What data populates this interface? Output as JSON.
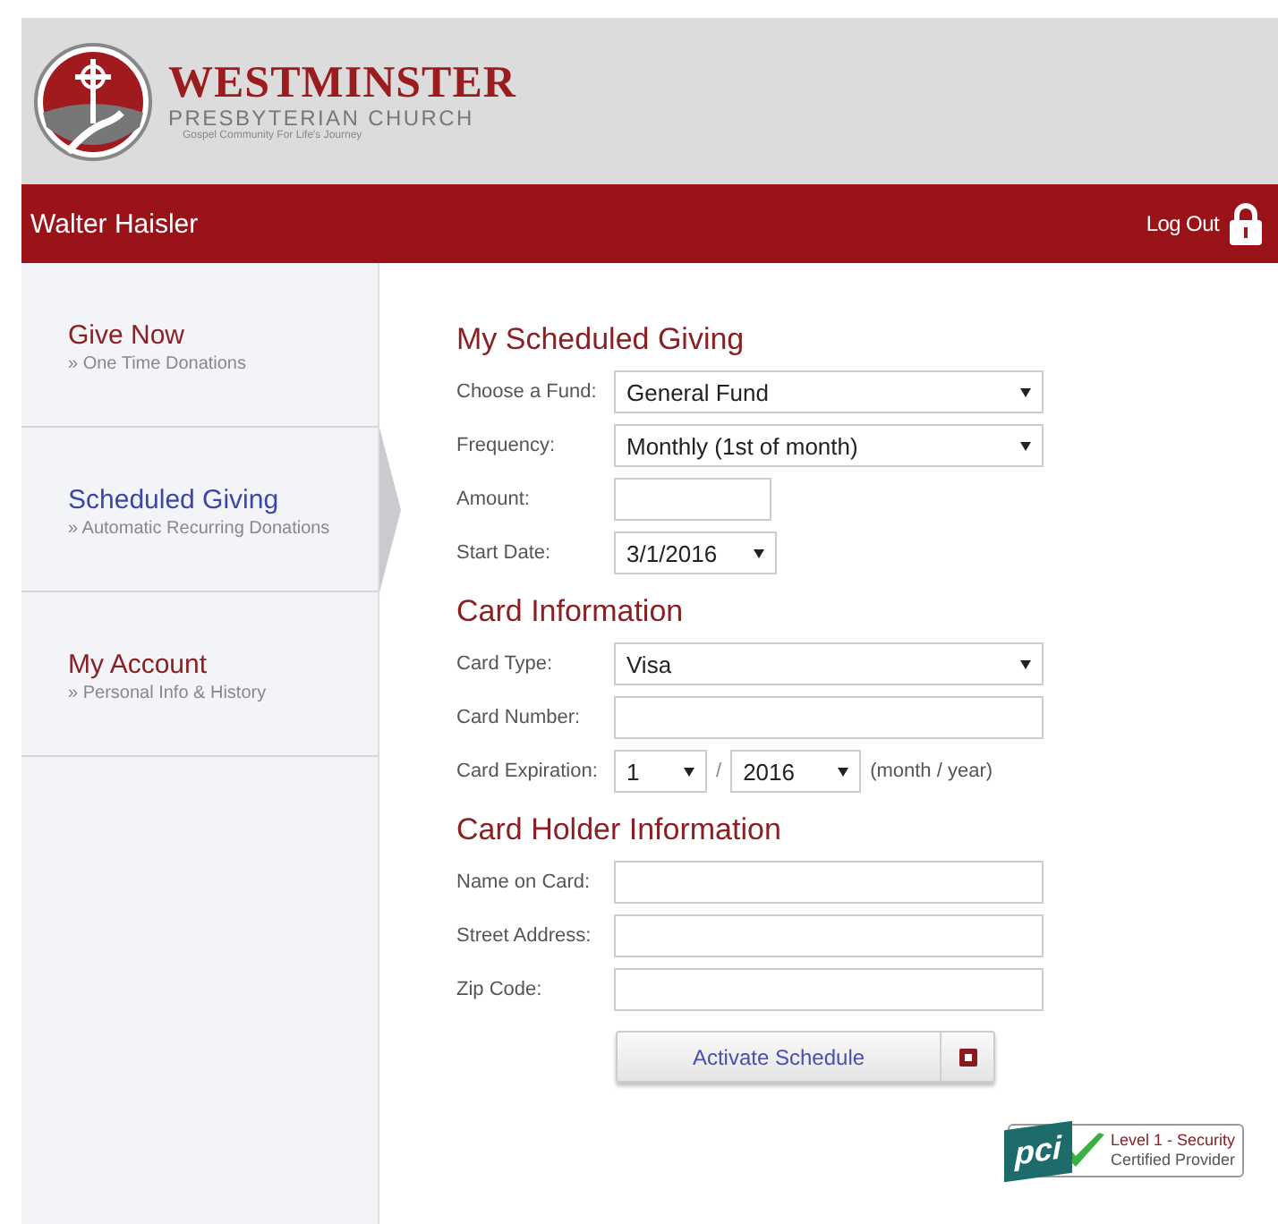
{
  "logo": {
    "name": "WESTMINSTER",
    "subtitle": "PRESBYTERIAN CHURCH",
    "tagline": "Gospel Community For Life's Journey"
  },
  "user_bar": {
    "user": "Walter Haisler",
    "logout": "Log Out"
  },
  "sidebar": {
    "items": [
      {
        "title": "Give Now",
        "subtitle": "» One Time Donations",
        "selected": false
      },
      {
        "title": "Scheduled Giving",
        "subtitle": "» Automatic Recurring Donations",
        "selected": true
      },
      {
        "title": "My Account",
        "subtitle": "» Personal Info & History",
        "selected": false
      }
    ]
  },
  "sections": [
    {
      "heading": "My Scheduled Giving",
      "fields": [
        {
          "kind": "select",
          "label": "Choose a Fund:",
          "value": "General Fund"
        },
        {
          "kind": "select",
          "label": "Frequency:",
          "value": "Monthly (1st of month)"
        },
        {
          "kind": "short_input",
          "label": "Amount:"
        },
        {
          "kind": "short_select",
          "label": "Start Date:",
          "value": "3/1/2016"
        }
      ]
    },
    {
      "heading": "Card Information",
      "fields": [
        {
          "kind": "select",
          "label": "Card Type:",
          "value": "Visa"
        },
        {
          "kind": "input",
          "label": "Card Number:"
        },
        {
          "kind": "expiry",
          "label": "Card Expiration:",
          "month": "1",
          "separator": "/",
          "year": "2016",
          "hint": "(month / year)"
        }
      ]
    },
    {
      "heading": "Card Holder Information",
      "fields": [
        {
          "kind": "input",
          "label": "Name on Card:"
        },
        {
          "kind": "input",
          "label": "Street Address:"
        },
        {
          "kind": "input",
          "label": "Zip Code:"
        }
      ]
    }
  ],
  "submit": {
    "label": "Activate Schedule"
  },
  "security_badge": {
    "logo": "pci",
    "line_1": "Level 1 - Security",
    "line_2": "Certified Provider"
  }
}
